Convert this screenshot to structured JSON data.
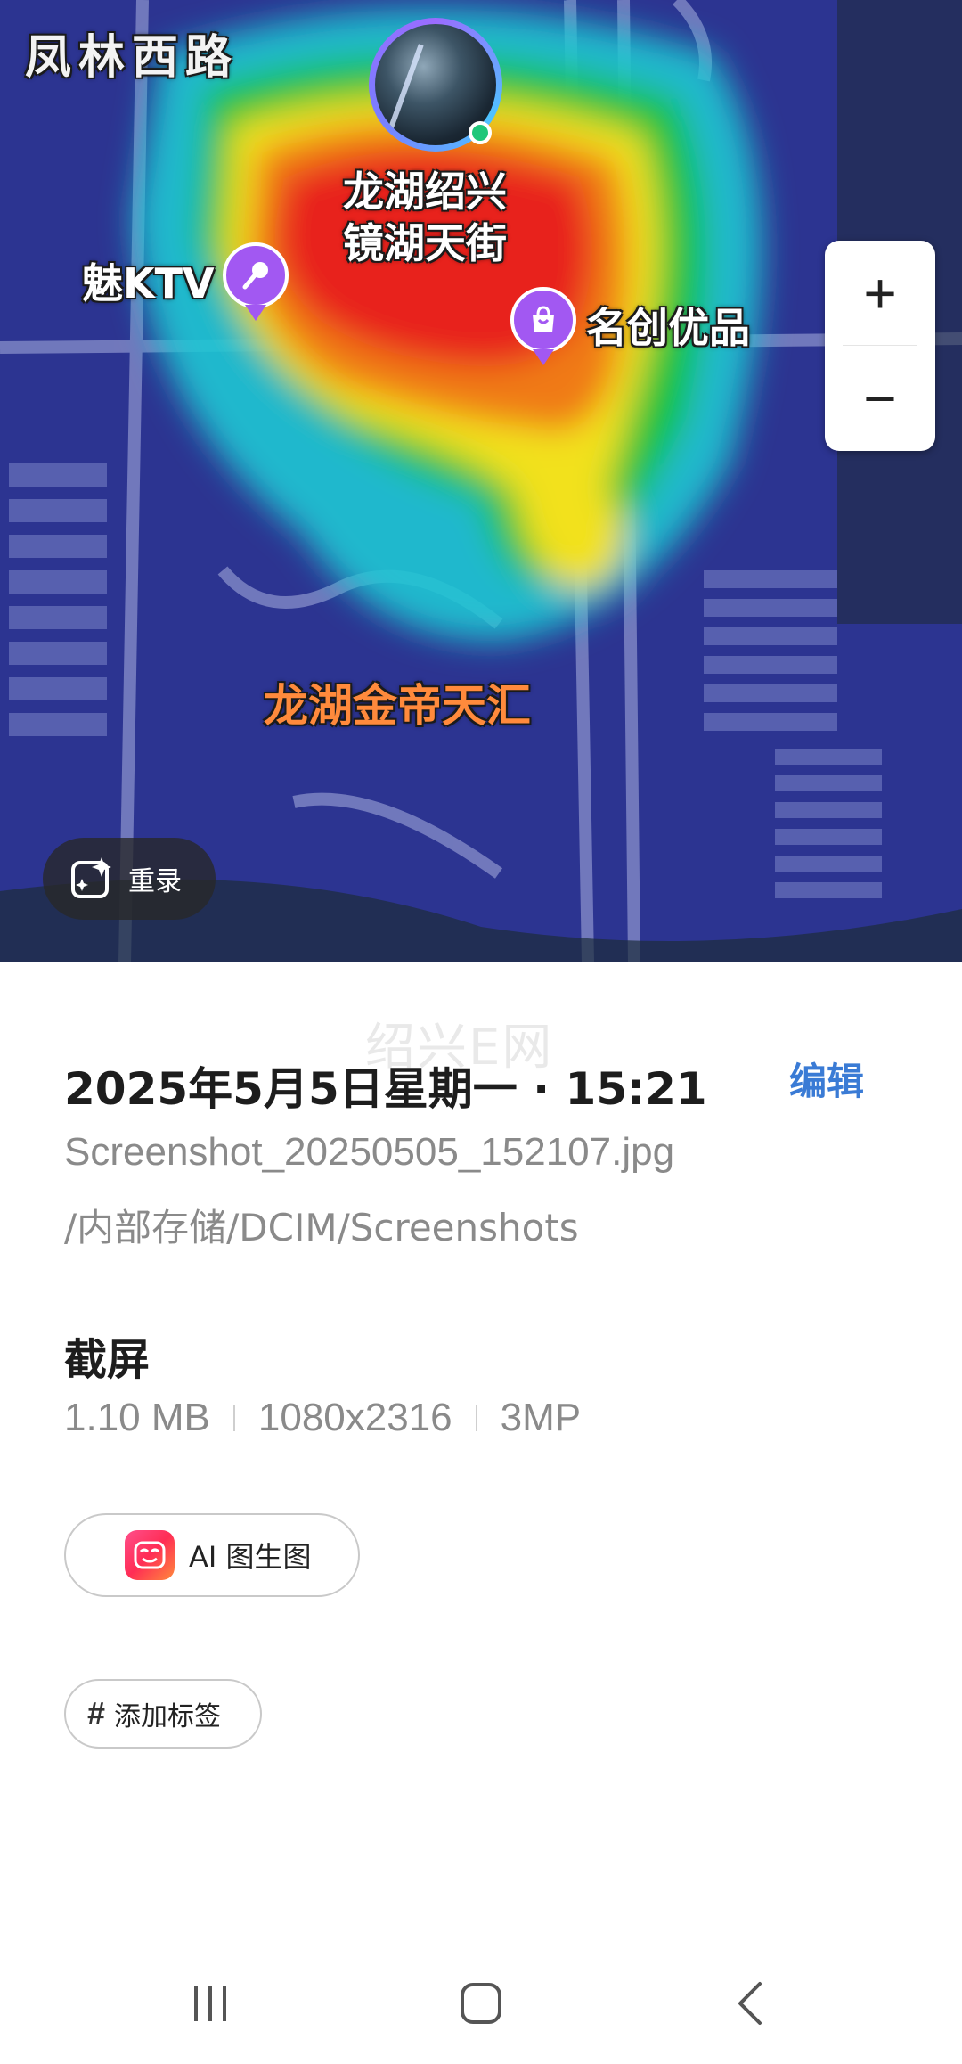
{
  "map": {
    "road_label": "凤林西路",
    "poi_main_line1": "龙湖绍兴",
    "poi_main_line2": "镜湖天街",
    "poi_ktv": "魅KTV",
    "poi_shop": "名创优品",
    "poi_complex": "龙湖金帝天汇",
    "zoom_in_label": "+",
    "zoom_out_label": "−",
    "rerecord_label": "重录",
    "heat_colors": [
      "#2b2fd6",
      "#1fc7d4",
      "#18c23a",
      "#f2e11a",
      "#f07a16",
      "#e8221b"
    ]
  },
  "details": {
    "watermark": "绍兴E网",
    "datetime": "2025年5月5日星期一 · 15:21",
    "edit_label": "编辑",
    "filename": "Screenshot_20250505_152107.jpg",
    "filepath": "/内部存储/DCIM/Screenshots",
    "section_title": "截屏",
    "size": "1.10 MB",
    "resolution": "1080x2316",
    "megapixels": "3MP",
    "ai_chip_label": "AI 图生图",
    "tag_chip_hash": "#",
    "tag_chip_label": "添加标签",
    "accent_color": "#3a7bd5"
  },
  "navbar": {
    "recent_icon": "recent-apps-icon",
    "home_icon": "home-icon",
    "back_icon": "back-icon"
  }
}
